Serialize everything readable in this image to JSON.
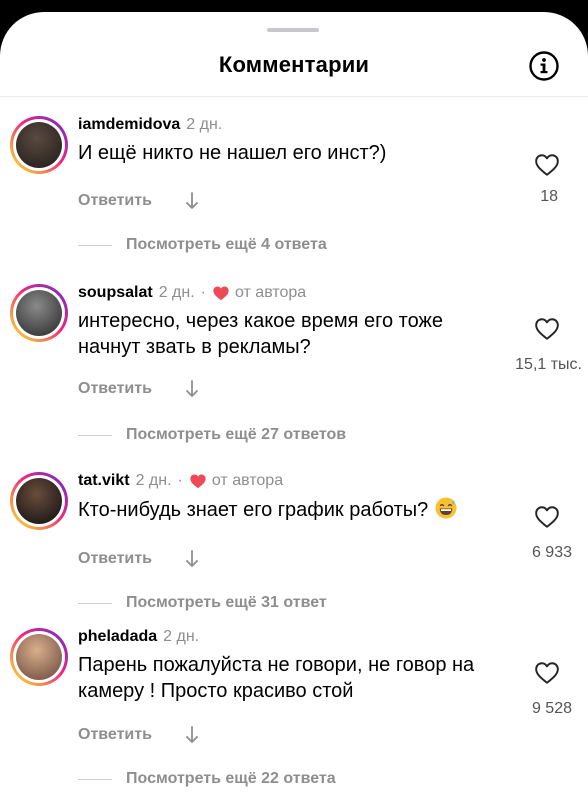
{
  "header": {
    "title": "Комментарии",
    "info_icon": "info-icon"
  },
  "reply_label": "Ответить",
  "comments": [
    {
      "username": "iamdemidova",
      "ago": "2 дн.",
      "author_liked": false,
      "text": "И ещё никто не нашел его инст?)",
      "likes": "18",
      "more_replies": "Посмотреть ещё 4 ответа",
      "avatar_colors": [
        "#5a4a40",
        "#2b2420"
      ]
    },
    {
      "username": "soupsalat",
      "ago": "2 дн.",
      "author_liked": true,
      "author_label": "от автора",
      "text": "интересно, через какое время его тоже начнут звать в рекламы?",
      "likes": "15,1 тыс.",
      "more_replies": "Посмотреть ещё 27 ответов",
      "avatar_colors": [
        "#8a8a8a",
        "#3a3a3a"
      ]
    },
    {
      "username": "tat.vikt",
      "ago": "2 дн.",
      "author_liked": true,
      "author_label": "от автора",
      "text": "Кто-нибудь знает его график работы?",
      "emoji": "grinning-sweat-emoji",
      "likes": "6 933",
      "more_replies": "Посмотреть ещё 31 ответ",
      "avatar_colors": [
        "#6b4c3b",
        "#1f1a18"
      ]
    },
    {
      "username": "pheladada",
      "ago": "2 дн.",
      "author_liked": false,
      "text": "Парень пожалуйста не говори, не говор на камеру ! Просто красиво стой",
      "likes": "9 528",
      "more_replies": "Посмотреть ещё 22 ответа",
      "avatar_colors": [
        "#d9b08c",
        "#7d5a4a"
      ]
    }
  ],
  "colors": {
    "story_ring": [
      "#f9ce34",
      "#ee2a7b",
      "#6228d7"
    ],
    "heart_red": "#ed4956",
    "muted_text": "#8e8e8e"
  }
}
